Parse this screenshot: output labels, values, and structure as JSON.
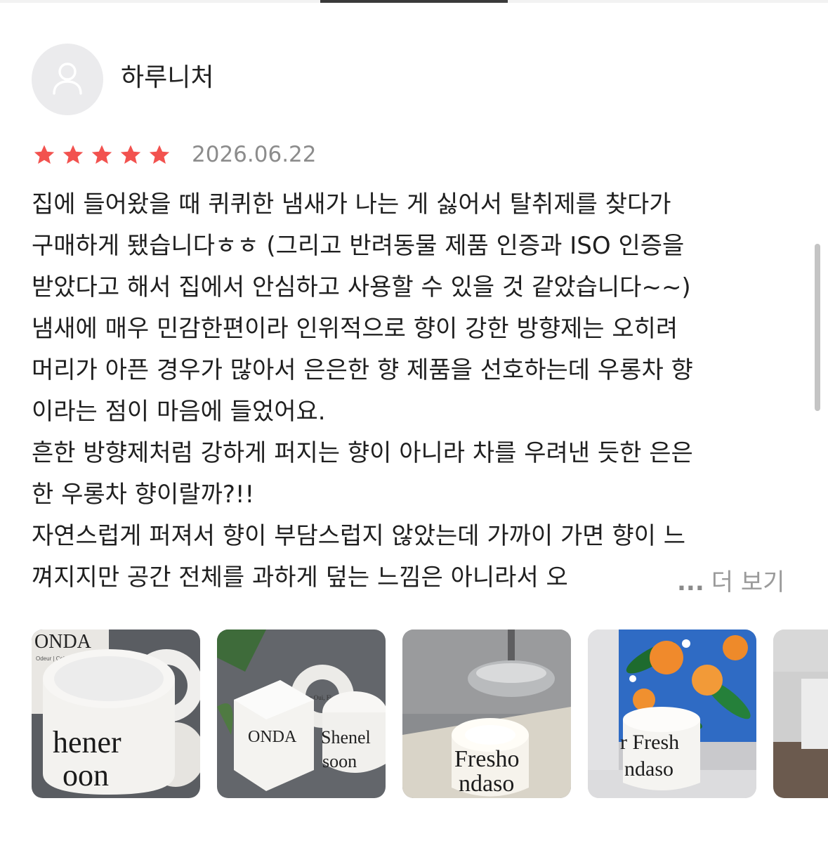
{
  "review": {
    "username": "하루니처",
    "rating": 5,
    "rating_max": 5,
    "date": "2026.06.22",
    "text_lines": [
      "집에 들어왔을 때 퀴퀴한 냄새가 나는 게 싫어서 탈취제를 찾다가",
      "구매하게 됐습니다ㅎㅎ (그리고 반려동물 제품 인증과 ISO 인증을",
      "받았다고 해서 집에서 안심하고 사용할 수 있을 것 같았습니다~~)",
      "냄새에 매우 민감한편이라 인위적으로 향이 강한 방향제는 오히려",
      "머리가 아픈 경우가 많아서 은은한 향 제품을 선호하는데 우롱차 향",
      "이라는 점이 마음에 들었어요.",
      "흔한 방향제처럼 강하게 퍼지는 향이 아니라 차를 우려낸 듯한 은은",
      "한 우롱차 향이랄까?!!",
      "자연스럽게 퍼져서 향이 부담스럽지 않았는데 가까이 가면 향이 느",
      "껴지지만 공간 전체를 과하게 덮는 느낌은 아니라서 오"
    ],
    "more_dots": "...",
    "more_label": "더 보기",
    "photos": [
      {
        "name": "photo-candle-open-lid",
        "label_lines": [
          "ONDA",
          "Odeur | Colonche",
          "hener",
          "oon"
        ]
      },
      {
        "name": "photo-candle-with-box",
        "label_lines": [
          "ONDA",
          "Shenel",
          "soon",
          "Odeur Oui, Fiore la"
        ]
      },
      {
        "name": "photo-candle-lit",
        "label_lines": [
          "Fresho",
          "ndaso"
        ]
      },
      {
        "name": "photo-candle-orange-art",
        "label_lines": [
          "r Fresh",
          "ndaso"
        ]
      },
      {
        "name": "photo-partial"
      }
    ]
  },
  "colors": {
    "star": "#f2524f",
    "date": "#8c8c8c",
    "more": "#9a9a9a",
    "avatar_bg": "#ebebed"
  }
}
